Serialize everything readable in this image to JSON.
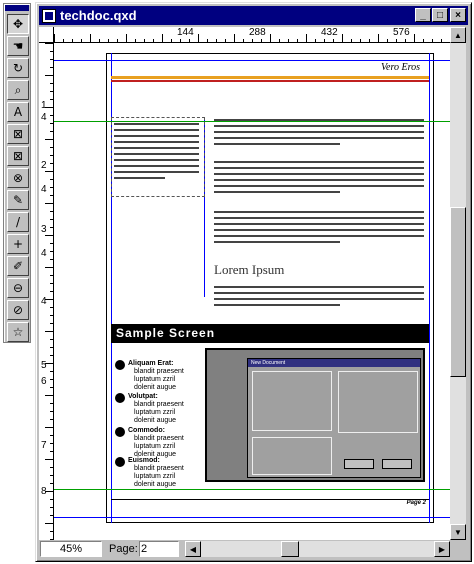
{
  "window": {
    "title": "techdoc.qxd"
  },
  "ruler": {
    "h_labels": [
      "144",
      "288",
      "432",
      "576"
    ],
    "v_labels": [
      "1",
      "4",
      "2",
      "4",
      "3",
      "4",
      "4",
      "5",
      "6",
      "7",
      "8"
    ]
  },
  "page": {
    "header_text": "Vero Eros",
    "heading": "Lorem Ipsum",
    "sample_title": "Sample Screen",
    "footer_text": "Page 2",
    "bullets": [
      {
        "title": "Aliquam Erat:",
        "body": "blandit praesent luptatum zzril dolenit augue"
      },
      {
        "title": "Volutpat:",
        "body": "blandit praesent luptatum zzril dolenit augue"
      },
      {
        "title": "Commodo:",
        "body": "blandit praesent luptatum zzril dolenit augue"
      },
      {
        "title": "Euismod:",
        "body": "blandit praesent luptatum zzril dolenit augue"
      }
    ],
    "dialog_title": "New Document"
  },
  "status": {
    "zoom": "45%",
    "page_label": "Page:",
    "page_value": "2"
  },
  "tools": [
    {
      "name": "item-tool",
      "glyph": "✥"
    },
    {
      "name": "content-tool",
      "glyph": "☚"
    },
    {
      "name": "rotation-tool",
      "glyph": "↻"
    },
    {
      "name": "zoom-tool",
      "glyph": "⌕"
    },
    {
      "name": "text-box-tool",
      "glyph": "A"
    },
    {
      "name": "rectangle-picture-box-tool",
      "glyph": "⊠"
    },
    {
      "name": "rounded-picture-box-tool",
      "glyph": "⊠"
    },
    {
      "name": "oval-picture-box-tool",
      "glyph": "⊗"
    },
    {
      "name": "polygon-picture-box-tool",
      "glyph": "✎"
    },
    {
      "name": "line-tool",
      "glyph": "/"
    },
    {
      "name": "orthogonal-line-tool",
      "glyph": "+"
    },
    {
      "name": "line-text-path-tool",
      "glyph": "✐"
    },
    {
      "name": "linking-tool",
      "glyph": "⊖"
    },
    {
      "name": "unlinking-tool",
      "glyph": "⊘"
    },
    {
      "name": "star-tool",
      "glyph": "☆"
    }
  ],
  "colors": {
    "title_bar": "#000080",
    "guide_blue": "#0000ff",
    "guide_green": "#00a000",
    "header_orange": "#e8a020"
  }
}
